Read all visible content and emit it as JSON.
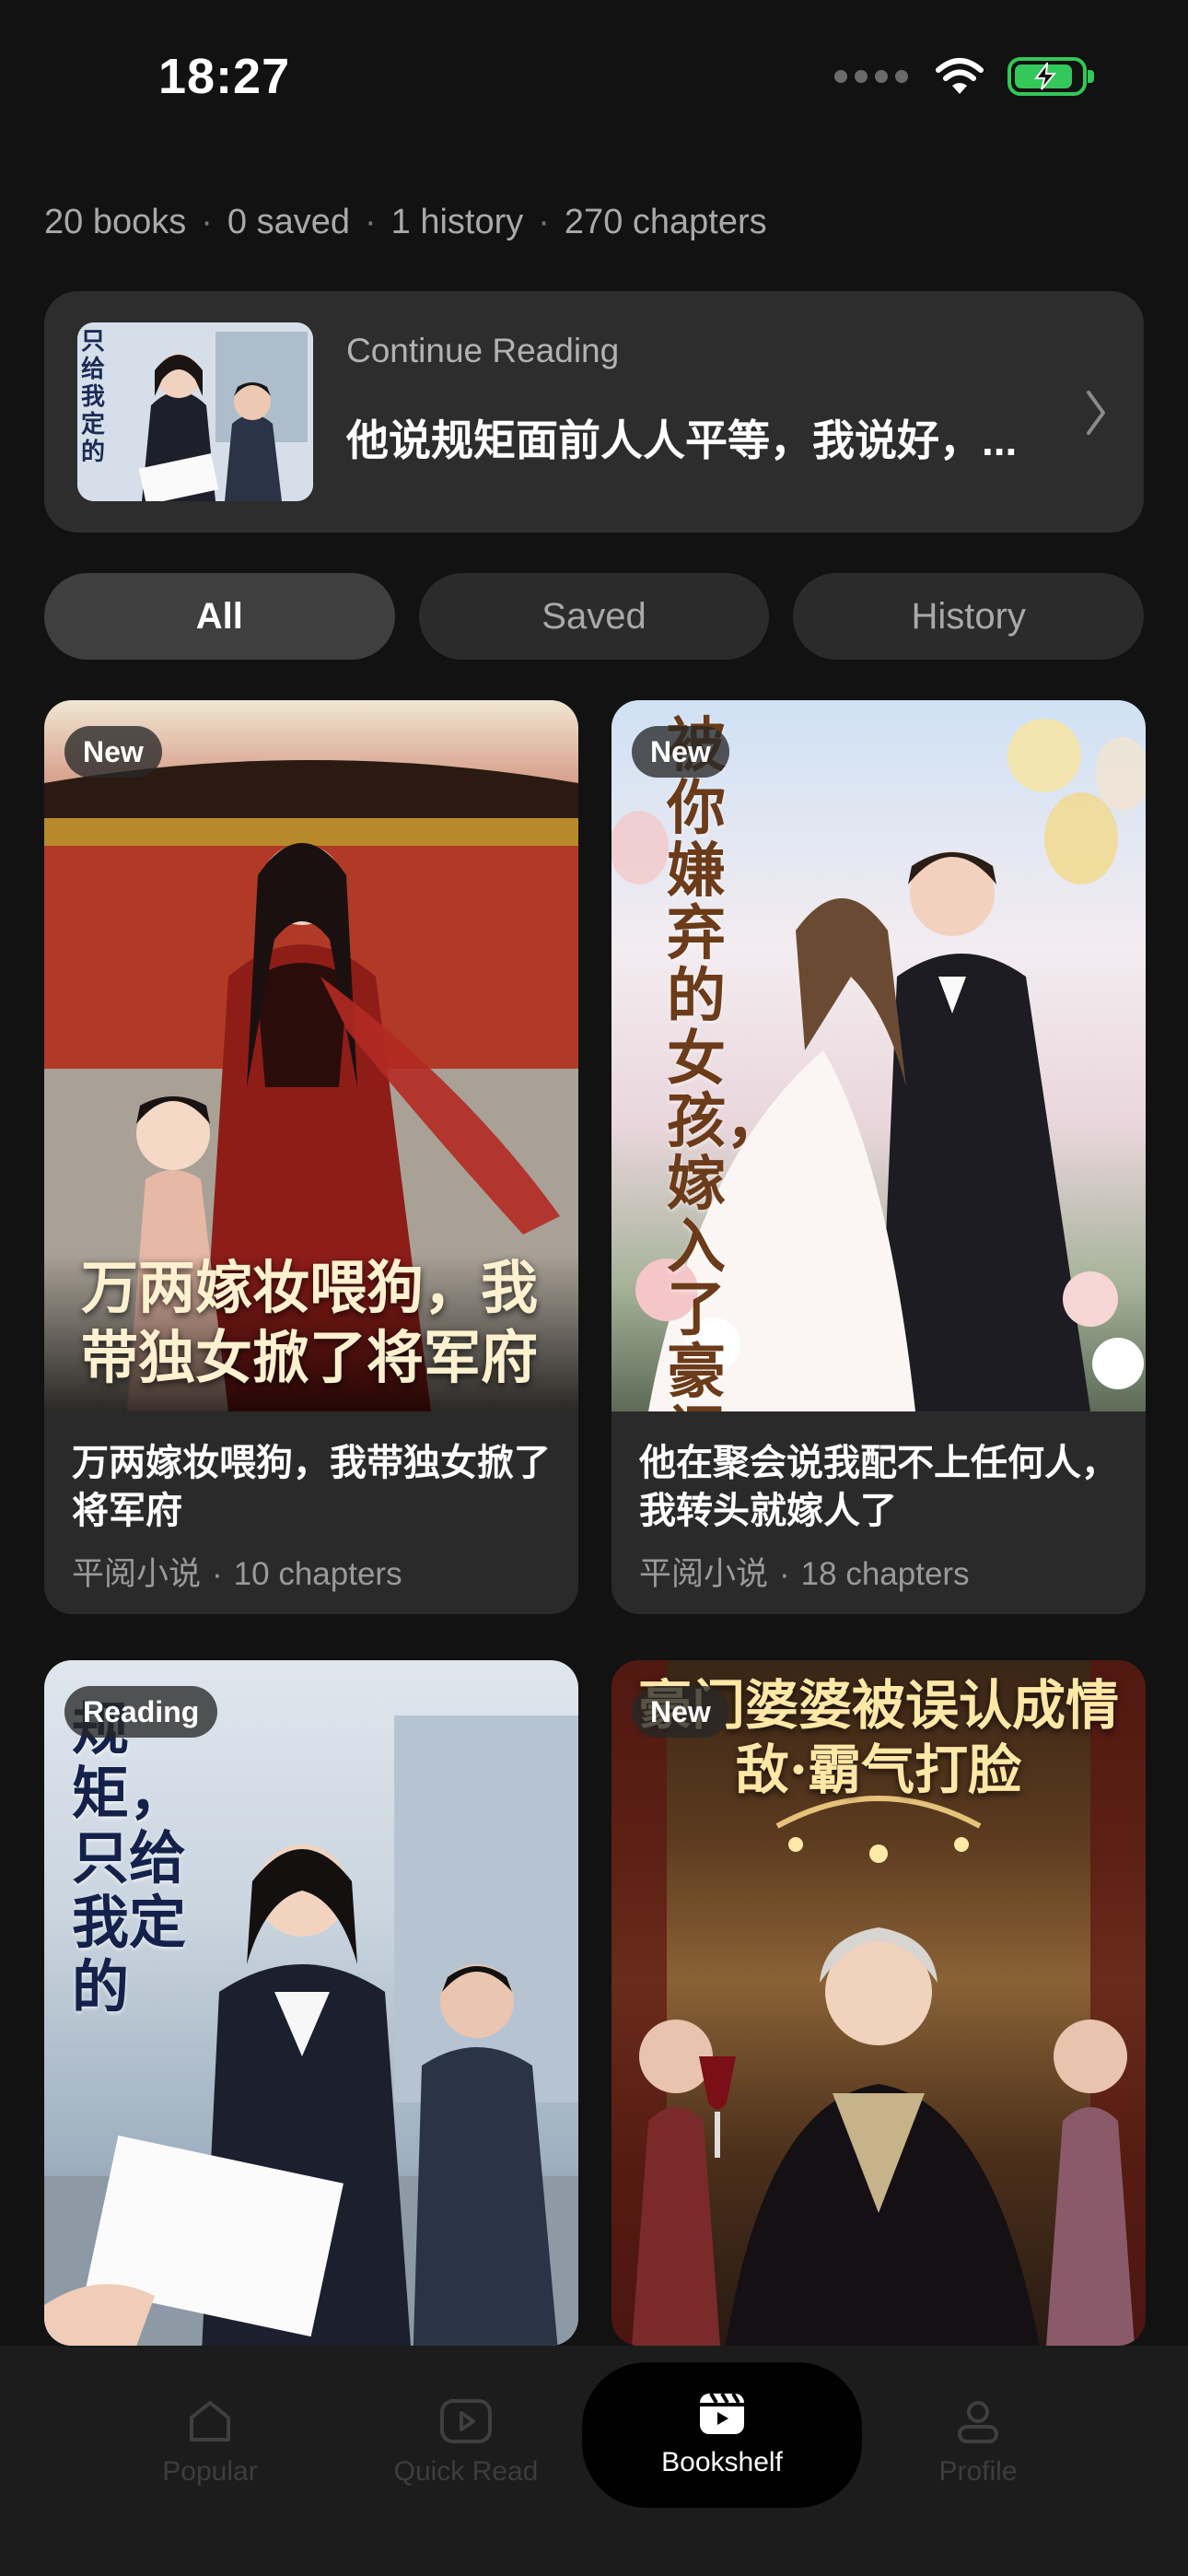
{
  "status": {
    "time": "18:27"
  },
  "summary": {
    "books": "20 books",
    "saved": "0 saved",
    "history": "1 history",
    "chapters": "270 chapters"
  },
  "continue_reading": {
    "label": "Continue Reading",
    "title": "他说规矩面前人人平等，我说好，...",
    "cover_text": "只给我定的"
  },
  "tabs": [
    {
      "label": "All",
      "active": true
    },
    {
      "label": "Saved",
      "active": false
    },
    {
      "label": "History",
      "active": false
    }
  ],
  "books": [
    {
      "badge": "New",
      "title": "万两嫁妆喂狗，我带独女掀了将军府",
      "source": "平阅小说",
      "chapters": "10 chapters",
      "cover_text": "万两嫁妆喂狗，我带独女掀了将军府"
    },
    {
      "badge": "New",
      "title": "他在聚会说我配不上任何人，我转头就嫁人了",
      "source": "平阅小说",
      "chapters": "18 chapters",
      "cover_text": "被你嫌弃的女孩，嫁入了豪门"
    },
    {
      "badge": "Reading",
      "title": "",
      "source": "",
      "chapters": "",
      "cover_text": "规矩，只给我定的"
    },
    {
      "badge": "New",
      "title": "",
      "source": "",
      "chapters": "",
      "cover_text": "豪门婆婆被误认成情敌·霸气打脸"
    }
  ],
  "nav": [
    {
      "label": "Popular",
      "icon": "home-icon",
      "active": false
    },
    {
      "label": "Quick Read",
      "icon": "play-icon",
      "active": false
    },
    {
      "label": "Bookshelf",
      "icon": "bookshelf-icon",
      "active": true
    },
    {
      "label": "Profile",
      "icon": "profile-icon",
      "active": false
    }
  ],
  "colors": {
    "background": "#121212",
    "card": "#2a2a2a",
    "battery": "#34c759"
  }
}
